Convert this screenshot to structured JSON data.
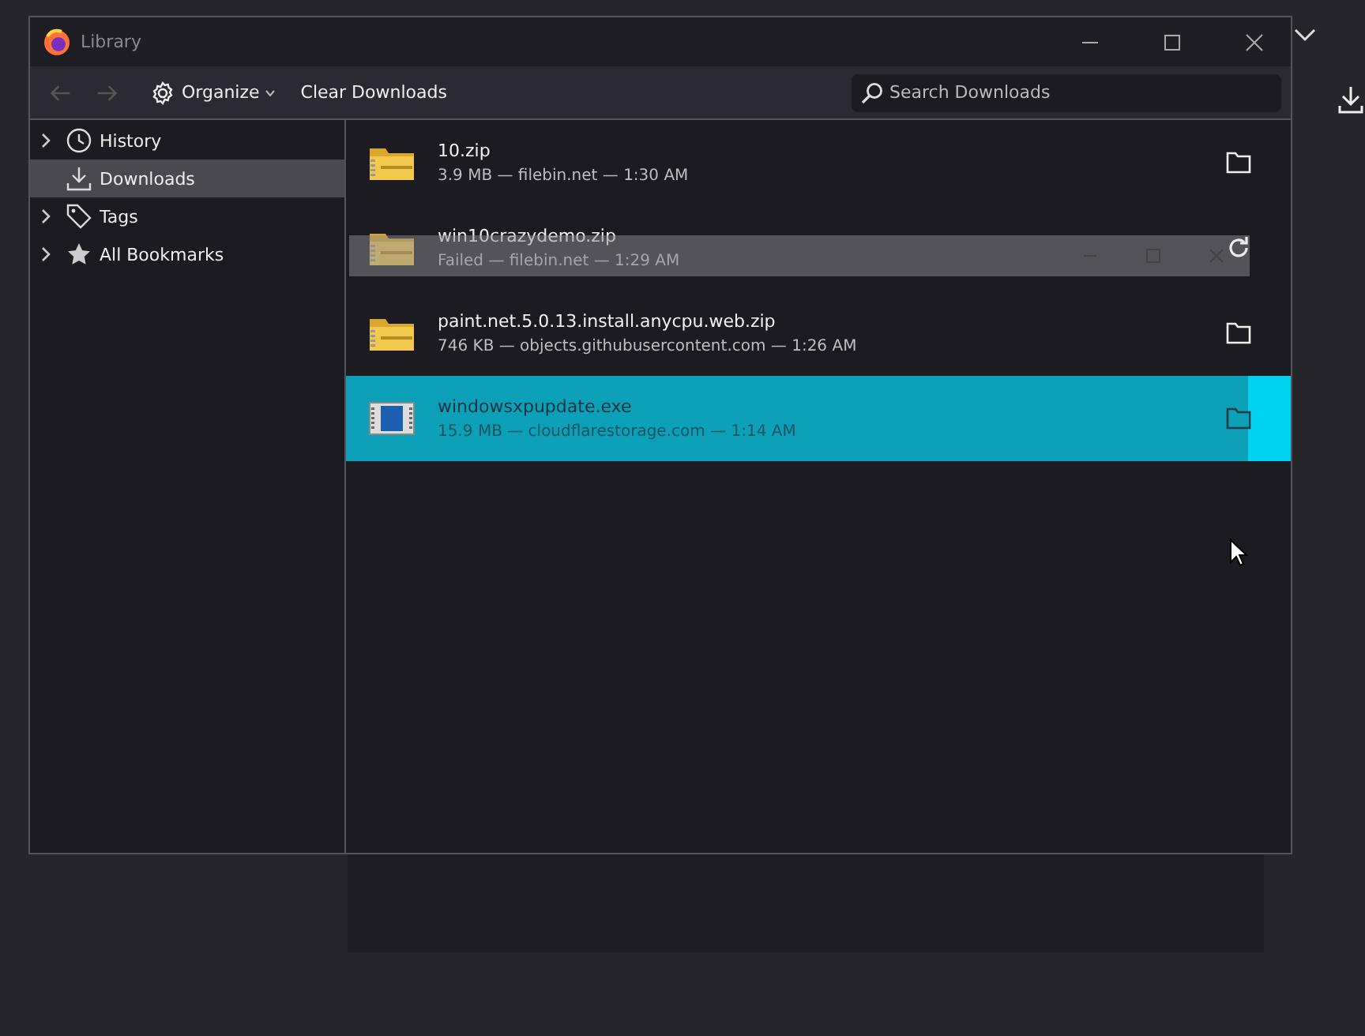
{
  "window": {
    "title": "Library"
  },
  "toolbar": {
    "organize": "Organize",
    "clear": "Clear Downloads",
    "search": {
      "placeholder": "Search Downloads"
    }
  },
  "sidebar": {
    "items": [
      {
        "label": "History",
        "expandable": true,
        "selected": false
      },
      {
        "label": "Downloads",
        "expandable": false,
        "selected": true
      },
      {
        "label": "Tags",
        "expandable": true,
        "selected": false
      },
      {
        "label": "All Bookmarks",
        "expandable": true,
        "selected": false
      }
    ]
  },
  "downloads": [
    {
      "name": "10.zip",
      "status": "3.9 MB — filebin.net — 1:30 AM",
      "kind": "zip",
      "failed": false,
      "selected": false
    },
    {
      "name": "win10crazydemo.zip",
      "status": "Failed — filebin.net — 1:29 AM",
      "kind": "zip",
      "failed": true,
      "selected": false
    },
    {
      "name": "paint.net.5.0.13.install.anycpu.web.zip",
      "status": "746 KB — objects.githubusercontent.com — 1:26 AM",
      "kind": "zip",
      "failed": false,
      "selected": false
    },
    {
      "name": "windowsxpupdate.exe",
      "status": "15.9 MB — cloudflarestorage.com — 1:14 AM",
      "kind": "exe",
      "failed": false,
      "selected": true
    }
  ]
}
